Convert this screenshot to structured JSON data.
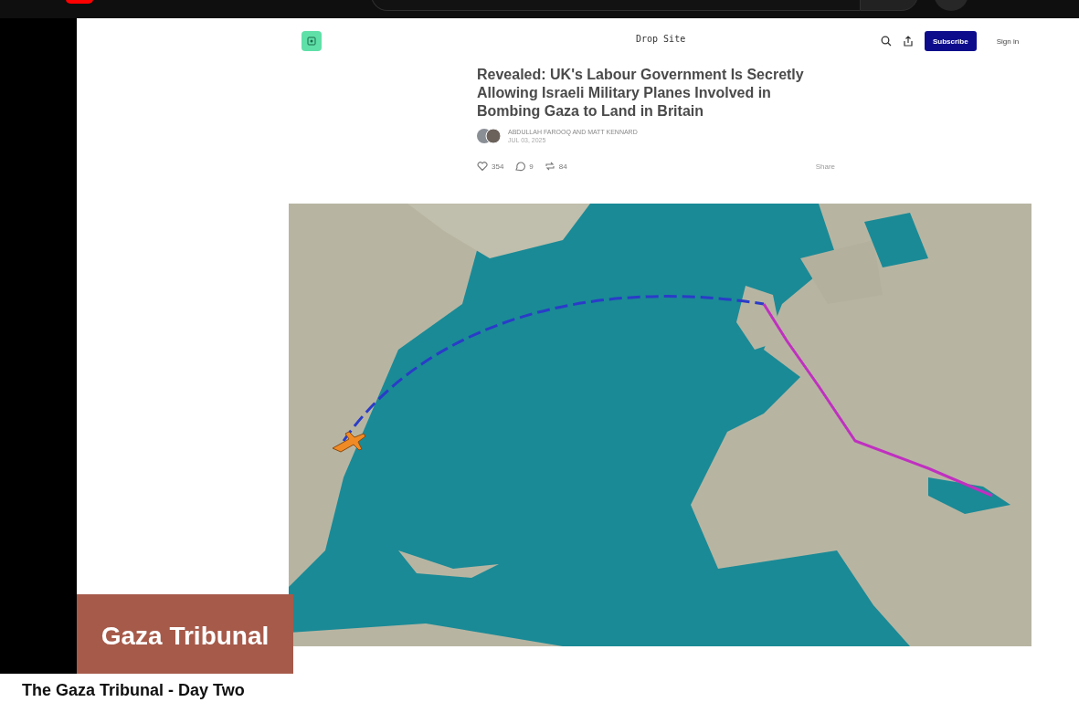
{
  "video_frame": {
    "site_name": "Drop Site",
    "subscribe_button": "Subscribe",
    "sign_in": "Sign in",
    "headline": "Revealed: UK's Labour Government Is Secretly Allowing Israeli Military Planes Involved in Bombing Gaza to Land in Britain",
    "byline": "ABDULLAH FAROOQ AND MATT KENNARD",
    "date": "JUL 03, 2025",
    "likes": "354",
    "comments": "9",
    "restacks": "84",
    "share": "Share",
    "overlay_banner": "Gaza Tribunal"
  },
  "video_title": "The Gaza Tribunal - Day Two"
}
